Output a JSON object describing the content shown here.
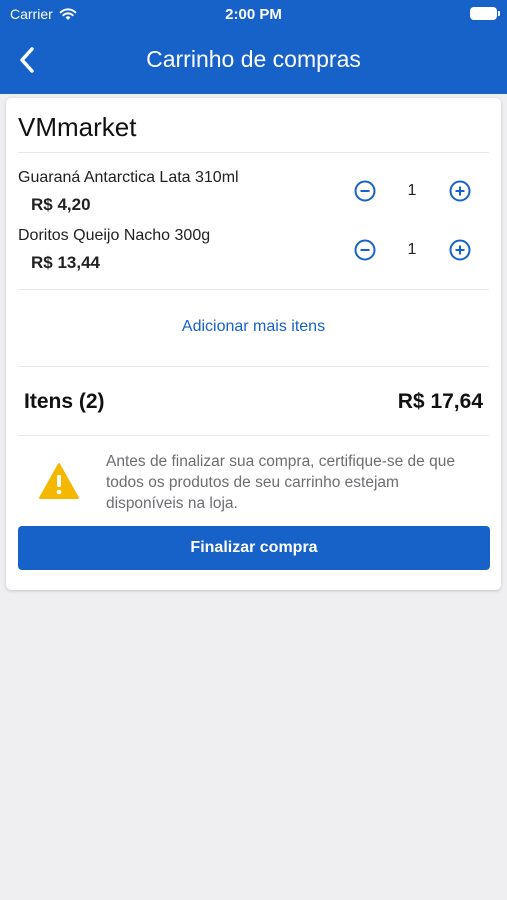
{
  "status_bar": {
    "carrier": "Carrier",
    "time": "2:00 PM"
  },
  "nav": {
    "title": "Carrinho de compras"
  },
  "cart": {
    "store_name": "VMmarket",
    "products": [
      {
        "name": "Guaraná Antarctica Lata 310ml",
        "price": "R$ 4,20",
        "quantity": "1"
      },
      {
        "name": "Doritos Queijo Nacho 300g",
        "price": "R$ 13,44",
        "quantity": "1"
      }
    ],
    "add_more_label": "Adicionar mais itens",
    "items_label": "Itens (2)",
    "total": "R$ 17,64",
    "warning": "Antes de finalizar sua compra, certifique-se de que todos os produtos de seu carrinho estejam disponíveis na loja.",
    "finish_label": "Finalizar compra"
  },
  "colors": {
    "primary": "#1662c8",
    "warning": "#f5b800",
    "background": "#efeff1"
  }
}
